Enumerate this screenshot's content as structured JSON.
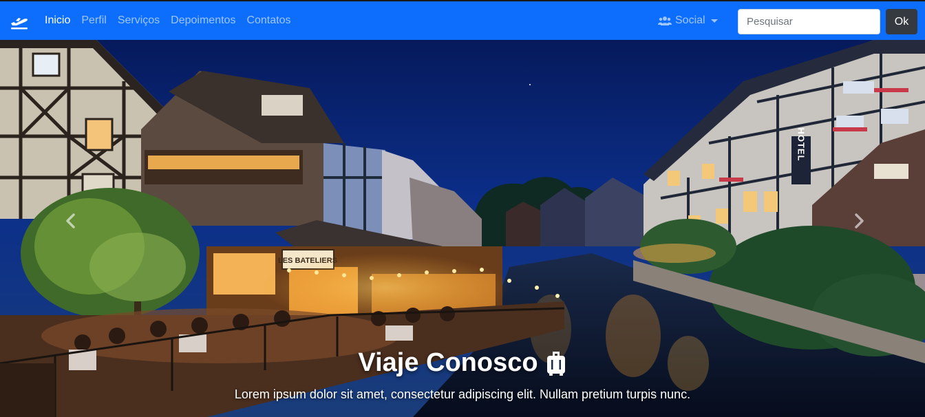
{
  "navbar": {
    "brand_icon": "plane-departure-icon",
    "links": [
      {
        "label": "Inicio",
        "active": true
      },
      {
        "label": "Perfil",
        "active": false
      },
      {
        "label": "Serviços",
        "active": false
      },
      {
        "label": "Depoimentos",
        "active": false
      },
      {
        "label": "Contatos",
        "active": false
      }
    ],
    "social": {
      "label": "Social",
      "icon": "users-icon"
    },
    "search": {
      "placeholder": "Pesquisar",
      "value": ""
    },
    "ok_label": "Ok",
    "colors": {
      "background": "#0d6efd",
      "button": "#343a40"
    }
  },
  "carousel": {
    "caption_title": "Viaje Conosco",
    "caption_icon": "suitcase-icon",
    "caption_text": "Lorem ipsum dolor sit amet, consectetur adipiscing elit. Nullam pretium turpis nunc.",
    "sign_les_bateliers": "LES BATELIERS",
    "sign_hotel": "HOTEL",
    "controls": {
      "prev_icon": "chevron-left-icon",
      "next_icon": "chevron-right-icon"
    }
  }
}
